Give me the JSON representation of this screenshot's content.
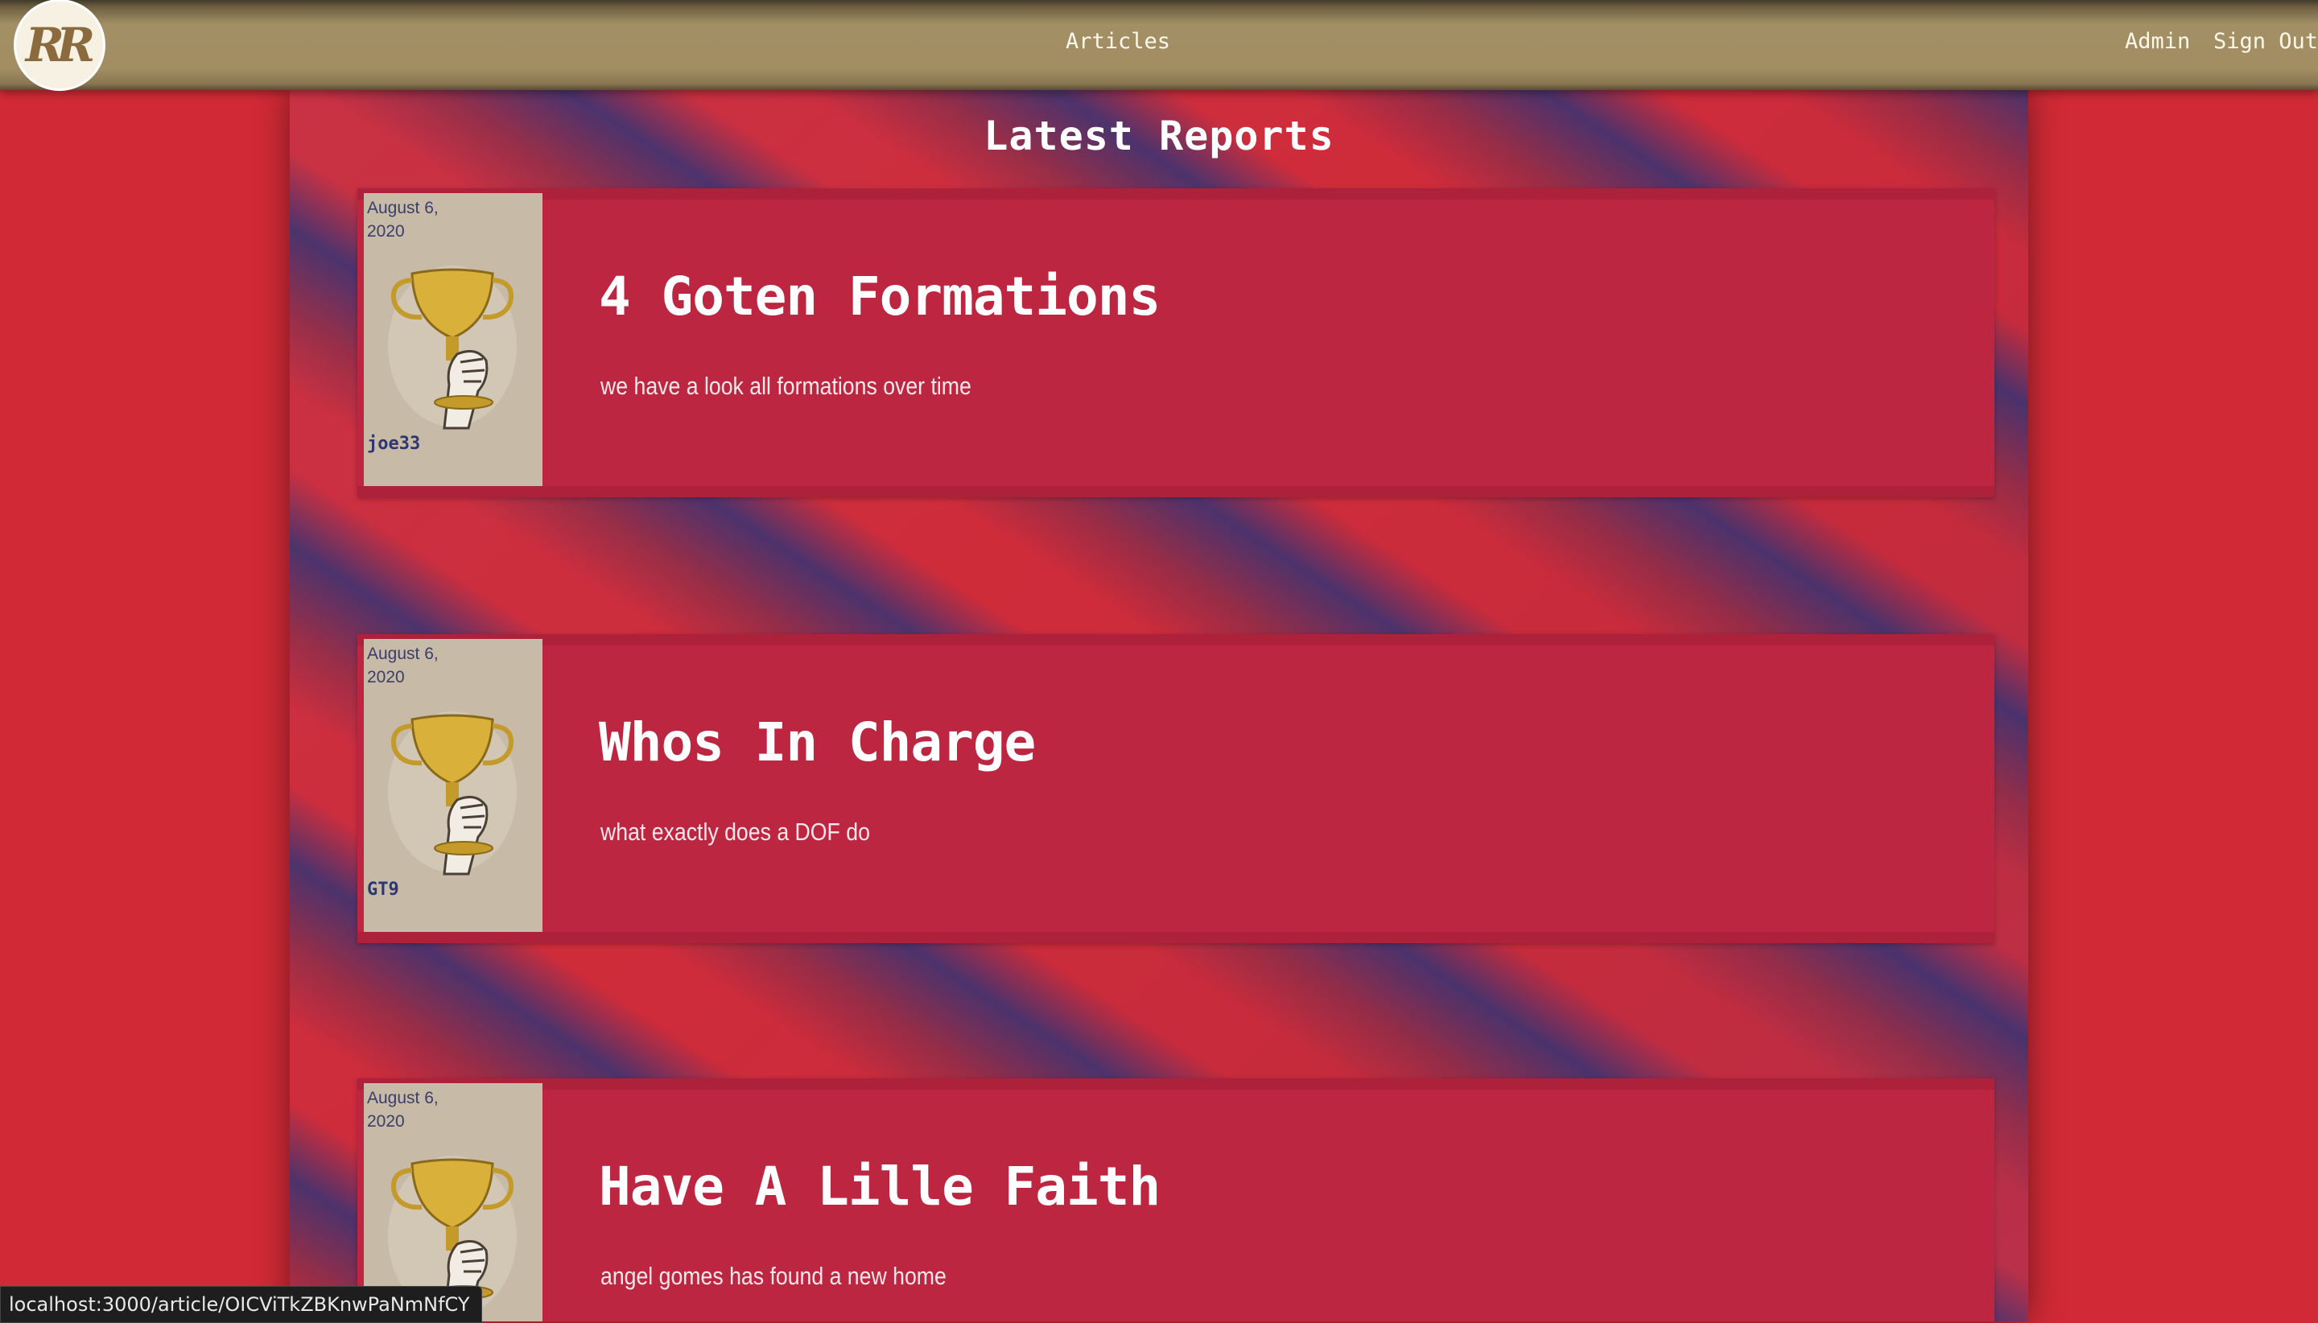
{
  "navbar": {
    "logo_text": "RR",
    "links": {
      "articles": "Articles",
      "admin": "Admin",
      "sign_out": "Sign Out"
    }
  },
  "main": {
    "title": "Latest Reports",
    "articles": [
      {
        "date": "August 6, 2020",
        "author": "joe33",
        "title": "4 Goten Formations",
        "description": "we have a look all formations over time",
        "image": "trophy-hand-illustration"
      },
      {
        "date": "August 6, 2020",
        "author": "GT9",
        "title": "Whos In Charge",
        "description": "what exactly does a DOF do",
        "image": "trophy-hand-illustration"
      },
      {
        "date": "August 6, 2020",
        "author": "",
        "title": "Have A Lille Faith",
        "description": "angel gomes has found a new home",
        "image": "trophy-hand-illustration"
      }
    ]
  },
  "status_bar": {
    "url": "localhost:3000/article/OICViTkZBKnwPaNmNfCY"
  },
  "colors": {
    "background": "#d12a36",
    "card": "#bd2640",
    "navbar": "#a38f65",
    "stripe_blue": "#2c3478"
  }
}
